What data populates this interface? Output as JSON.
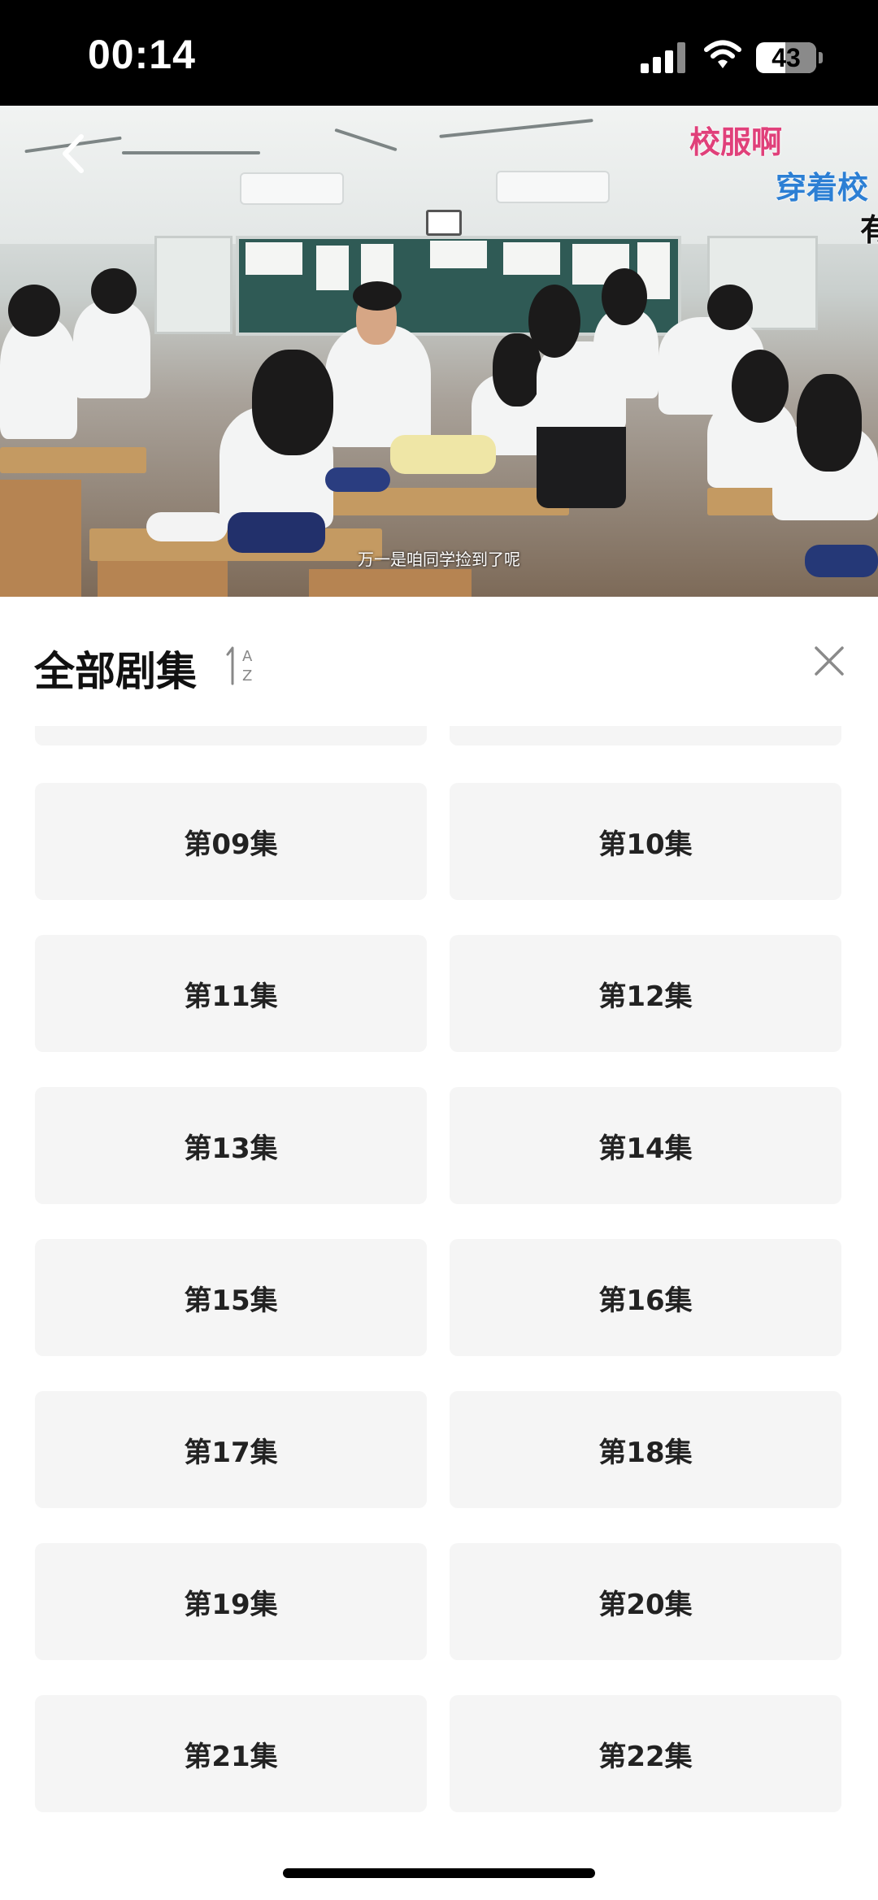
{
  "status_bar": {
    "time": "00:14",
    "battery": "43",
    "icons": [
      "signal-icon",
      "wifi-icon",
      "battery-icon"
    ]
  },
  "video": {
    "subtitle": "万一是咱同学捡到了呢",
    "back_icon": "chevron-left-icon",
    "danmaku": [
      {
        "text": "校服啊",
        "color": "#e0407a"
      },
      {
        "text": "穿着校",
        "color": "#2c7fd4"
      },
      {
        "text": "有",
        "color": "#111111"
      }
    ]
  },
  "sheet": {
    "title": "全部剧集",
    "sort_icon": "sort-az-icon",
    "close_icon": "close-icon",
    "episodes": [
      "",
      "",
      "第09集",
      "第10集",
      "第11集",
      "第12集",
      "第13集",
      "第14集",
      "第15集",
      "第16集",
      "第17集",
      "第18集",
      "第19集",
      "第20集",
      "第21集",
      "第22集"
    ]
  },
  "colors": {
    "episode_bg": "#f5f5f5",
    "episode_text": "#222222",
    "status_bg": "#000000"
  }
}
